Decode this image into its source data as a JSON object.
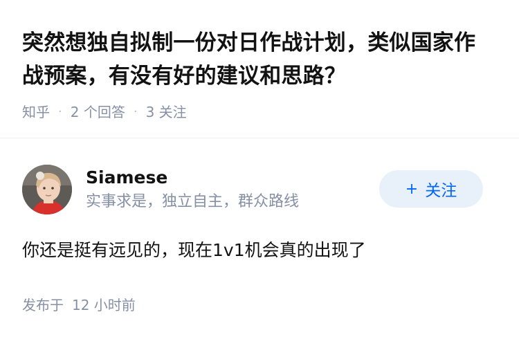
{
  "question": {
    "title": "突然想独自拟制一份对日作战计划，类似国家作战预案，有没有好的建议和思路？",
    "source": "知乎",
    "answers_count": "2 个回答",
    "followers_count": "3 关注"
  },
  "answer": {
    "author": {
      "name": "Siamese",
      "bio": "实事求是，独立自主，群众路线",
      "avatar_icon": "avatar-photo"
    },
    "follow_button": {
      "icon": "plus-icon",
      "plus": "+",
      "label": "关注",
      "color": "#0066ff",
      "background": "#e8f0fa"
    },
    "content": "你还是挺有远见的，现在1v1机会真的出现了",
    "published_label": "发布于",
    "published_time": "12 小时前"
  },
  "colors": {
    "text_primary": "#121212",
    "text_secondary": "#8590a6",
    "accent": "#0066ff"
  }
}
